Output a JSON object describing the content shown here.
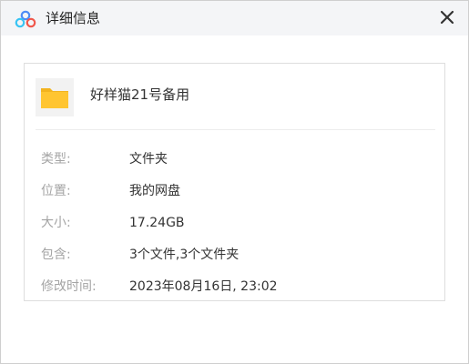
{
  "window": {
    "title": "详细信息",
    "close_label": "×"
  },
  "file": {
    "name": "好样猫21号备用",
    "icon": "folder-icon"
  },
  "details": [
    {
      "label": "类型:",
      "value": "文件夹"
    },
    {
      "label": "位置:",
      "value": "我的网盘"
    },
    {
      "label": "大小:",
      "value": "17.24GB"
    },
    {
      "label": "包含:",
      "value": "3个文件,3个文件夹"
    },
    {
      "label": "修改时间:",
      "value": "2023年08月16日, 23:02"
    }
  ],
  "colors": {
    "titlebar_bg": "#f4f5f7",
    "folder_yellow": "#ffc531",
    "label_gray": "#a4a4a4",
    "value_text": "#333333"
  }
}
